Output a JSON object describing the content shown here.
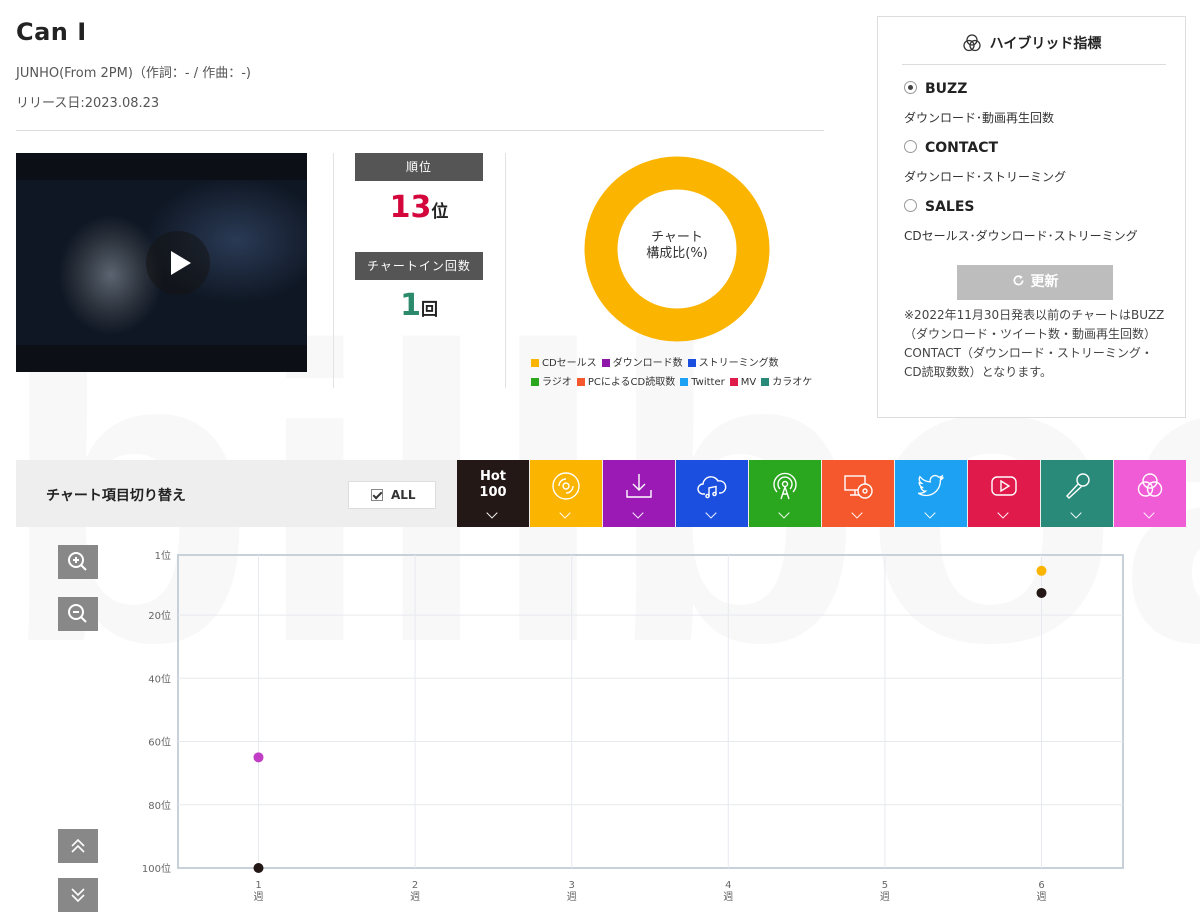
{
  "song": {
    "title": "Can I",
    "artist_line": "JUNHO(From 2PM)（作詞：- / 作曲：-)",
    "release_line": "リリース日:2023.08.23"
  },
  "video": {
    "play_icon": "play-icon"
  },
  "rank": {
    "label": "順位",
    "value": "13",
    "unit": "位",
    "chartin_label": "チャートイン回数",
    "chartin_value_first": "1",
    "chartin_unit": "回"
  },
  "composition": {
    "label_line1": "チャート",
    "label_line2": "構成比(%)",
    "slices": [
      {
        "name": "CDセールス",
        "percent": 100,
        "color": "#fbb400"
      }
    ],
    "legend": [
      {
        "name": "CDセールス",
        "color": "#fbb400"
      },
      {
        "name": "ダウンロード数",
        "color": "#8e16a8"
      },
      {
        "name": "ストリーミング数",
        "color": "#1b4fe0"
      },
      {
        "name": "ラジオ",
        "color": "#2aa71e"
      },
      {
        "name": "PCによるCD読取数",
        "color": "#f4582c"
      },
      {
        "name": "Twitter",
        "color": "#1da1f2"
      },
      {
        "name": "MV",
        "color": "#e01b4c"
      },
      {
        "name": "カラオケ",
        "color": "#2a8a7a"
      }
    ]
  },
  "hybrid": {
    "title": "ハイブリッド指標",
    "icon": "hybrid-circles-icon",
    "options": [
      {
        "name": "BUZZ",
        "desc": "ダウンロード･動画再生回数",
        "selected": true
      },
      {
        "name": "CONTACT",
        "desc": "ダウンロード･ストリーミング",
        "selected": false
      },
      {
        "name": "SALES",
        "desc": "CDセールス･ダウンロード･ストリーミング",
        "selected": false
      }
    ],
    "refresh_label": "更新",
    "refresh_icon": "refresh-icon",
    "note": "※2022年11月30日発表以前のチャートはBUZZ（ダウンロード・ツイート数・動画再生回数）CONTACT（ダウンロード・ストリーミング・CD読取数数）となります。"
  },
  "toolbar": {
    "title": "チャート項目切り替え",
    "all_label": "ALL",
    "tabs": [
      {
        "id": "hot100",
        "line1": "Hot",
        "line2": "100",
        "color": "#231815"
      },
      {
        "id": "cd",
        "icon": "cd-icon",
        "color": "#fbb400"
      },
      {
        "id": "download",
        "icon": "download-icon",
        "color": "#9b19b5"
      },
      {
        "id": "streaming",
        "icon": "cloud-music-icon",
        "color": "#1b4fe0"
      },
      {
        "id": "radio",
        "icon": "radio-icon",
        "color": "#2aa71e"
      },
      {
        "id": "pc-cd",
        "icon": "pc-cd-icon",
        "color": "#f4582c"
      },
      {
        "id": "twitter",
        "icon": "twitter-icon",
        "color": "#1da1f2"
      },
      {
        "id": "mv",
        "icon": "youtube-icon",
        "color": "#e01b4c"
      },
      {
        "id": "karaoke",
        "icon": "microphone-icon",
        "color": "#2a8a7a"
      },
      {
        "id": "hybrid",
        "icon": "hybrid-circles-icon",
        "color": "#f05bd6"
      }
    ]
  },
  "chart_data": {
    "type": "scatter",
    "y_tick_labels": [
      "1位",
      "20位",
      "40位",
      "60位",
      "80位",
      "100位"
    ],
    "y_ticks": [
      1,
      20,
      40,
      60,
      80,
      100
    ],
    "x_tick_labels": [
      [
        "1",
        "週"
      ],
      [
        "2",
        "週"
      ],
      [
        "3",
        "週"
      ],
      [
        "4",
        "週"
      ],
      [
        "5",
        "週"
      ],
      [
        "6",
        "週"
      ]
    ],
    "x_ticks": [
      1,
      2,
      3,
      4,
      5,
      6
    ],
    "ylim": [
      1,
      100
    ],
    "y_inverted": true,
    "grid": true,
    "series": [
      {
        "color": "#231815",
        "points": [
          [
            1,
            100
          ],
          [
            6,
            13
          ]
        ]
      },
      {
        "color": "#fbb400",
        "points": [
          [
            6,
            6
          ]
        ]
      },
      {
        "color": "#c13ec4",
        "points": [
          [
            1,
            65
          ]
        ]
      }
    ]
  }
}
